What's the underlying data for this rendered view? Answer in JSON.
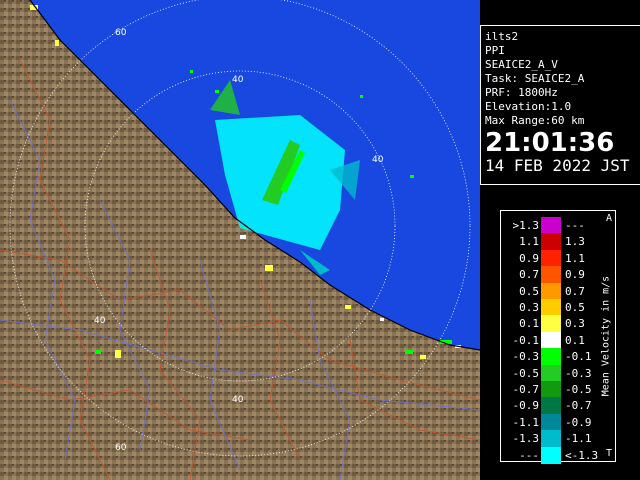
{
  "radar": {
    "station": "ilts2",
    "mode": "PPI",
    "product": "SEAICE2_A_V",
    "task": "Task: SEAICE2_A",
    "prf": "PRF: 1800Hz",
    "elevation": "Elevation:1.0",
    "max_range": "Max Range:60 km",
    "time": "21:01:36",
    "date": "14 FEB 2022 JST"
  },
  "range_labels": [
    "60",
    "40",
    "40",
    "40",
    "40",
    "60"
  ],
  "legend": {
    "title": "Mean Velocity in m/s",
    "top_marker": "A",
    "bottom_marker": "T",
    "rows": [
      {
        "low": ">1.3",
        "high": "---",
        "color": "#cc00cc"
      },
      {
        "low": "1.1",
        "high": "1.3",
        "color": "#cc0000"
      },
      {
        "low": "0.9",
        "high": "1.1",
        "color": "#ff2200"
      },
      {
        "low": "0.7",
        "high": "0.9",
        "color": "#ff5500"
      },
      {
        "low": "0.5",
        "high": "0.7",
        "color": "#ff9900"
      },
      {
        "low": "0.3",
        "high": "0.5",
        "color": "#ffcc00"
      },
      {
        "low": "0.1",
        "high": "0.3",
        "color": "#ffff44"
      },
      {
        "low": "-0.1",
        "high": "0.1",
        "color": "#ffffff"
      },
      {
        "low": "-0.3",
        "high": "-0.1",
        "color": "#00ff00"
      },
      {
        "low": "-0.5",
        "high": "-0.3",
        "color": "#22cc22"
      },
      {
        "low": "-0.7",
        "high": "-0.5",
        "color": "#119911"
      },
      {
        "low": "-0.9",
        "high": "-0.7",
        "color": "#007744"
      },
      {
        "low": "-1.1",
        "high": "-0.9",
        "color": "#008899"
      },
      {
        "low": "-1.3",
        "high": "-1.1",
        "color": "#00bbcc"
      },
      {
        "low": "---",
        "high": "<-1.3",
        "color": "#00ffff"
      }
    ]
  },
  "colors": {
    "sea": "#1848e0",
    "land": "#8a7456",
    "ring": "#ffffff"
  }
}
